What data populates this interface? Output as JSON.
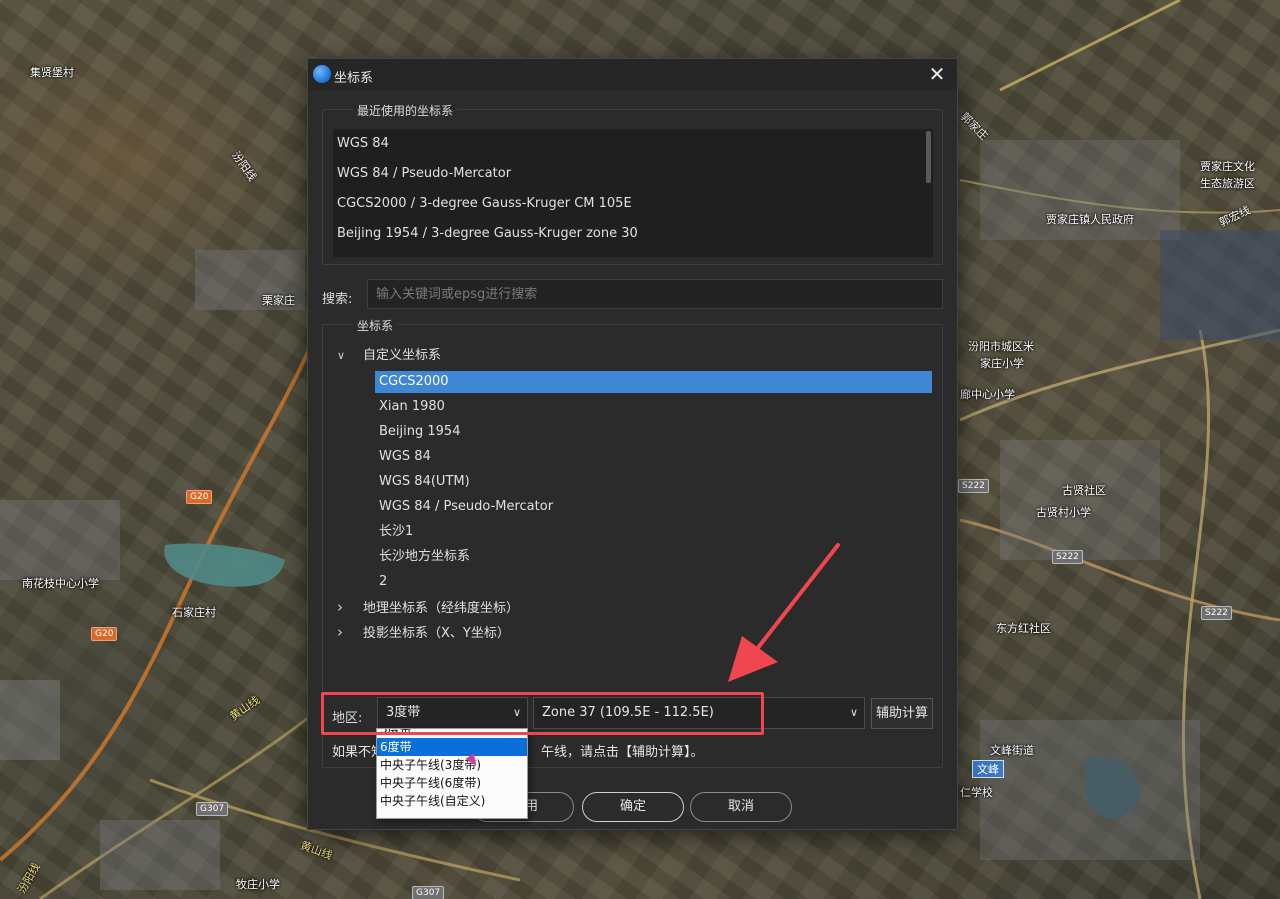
{
  "map": {
    "labels": [
      "集贤堡村",
      "汾阳线",
      "栗家庄",
      "石家庄村",
      "南花枝中心小学",
      "郭家庄",
      "贾家庄文化",
      "生态旅游区",
      "贾家庄镇人民政府",
      "郭宏线",
      "汾阳市城区米",
      "家庄小学",
      "廊中心小学",
      "古贤社区",
      "古贤村小学",
      "东方红社区",
      "文峰街道",
      "文峰",
      "仁学校",
      "牧庄小学",
      "黄山线",
      "黄山线",
      "汾阳线"
    ],
    "roads": [
      "G20",
      "G20",
      "G307",
      "G307",
      "S222",
      "S222",
      "S222"
    ]
  },
  "dialog": {
    "title": "坐标系",
    "close_symbol": "✕",
    "recent": {
      "title": "最近使用的坐标系",
      "items": [
        "WGS 84",
        "WGS 84 / Pseudo-Mercator",
        "CGCS2000 / 3-degree Gauss-Kruger CM 105E",
        "Beijing 1954 / 3-degree Gauss-Kruger zone 30"
      ]
    },
    "search": {
      "label": "搜索:",
      "placeholder": "输入关键词或epsg进行搜索"
    },
    "crs": {
      "title": "坐标系",
      "custom_group": "自定义坐标系",
      "custom_items": [
        "CGCS2000",
        "Xian 1980",
        "Beijing 1954",
        "WGS 84",
        "WGS 84(UTM)",
        "WGS 84 / Pseudo-Mercator",
        "长沙1",
        "长沙地方坐标系",
        "2"
      ],
      "geo_group": "地理坐标系（经纬度坐标）",
      "proj_group": "投影坐标系（X、Y坐标）",
      "expanded_arrow": "∨",
      "collapsed_arrow": "›"
    },
    "region": {
      "label": "地区:",
      "band_value": "3度带",
      "zone_value": "Zone 37 (109.5E - 112.5E)",
      "helper_button": "辅助计算",
      "hint_prefix": "如果不知",
      "hint_suffix": "午线，请点击【辅助计算】。",
      "chevron": "∨"
    },
    "footer": {
      "partial_button_tail": "用",
      "ok": "确定",
      "cancel": "取消"
    }
  },
  "dropdown": {
    "options": [
      "3度带",
      "6度带",
      "中央子午线(3度带)",
      "中央子午线(6度带)",
      "中央子午线(自定义)"
    ],
    "highlighted": "6度带"
  },
  "colors": {
    "selection": "#3f86d4",
    "dropdown_highlight": "#0a6fd8",
    "annotation": "#f0464f"
  }
}
